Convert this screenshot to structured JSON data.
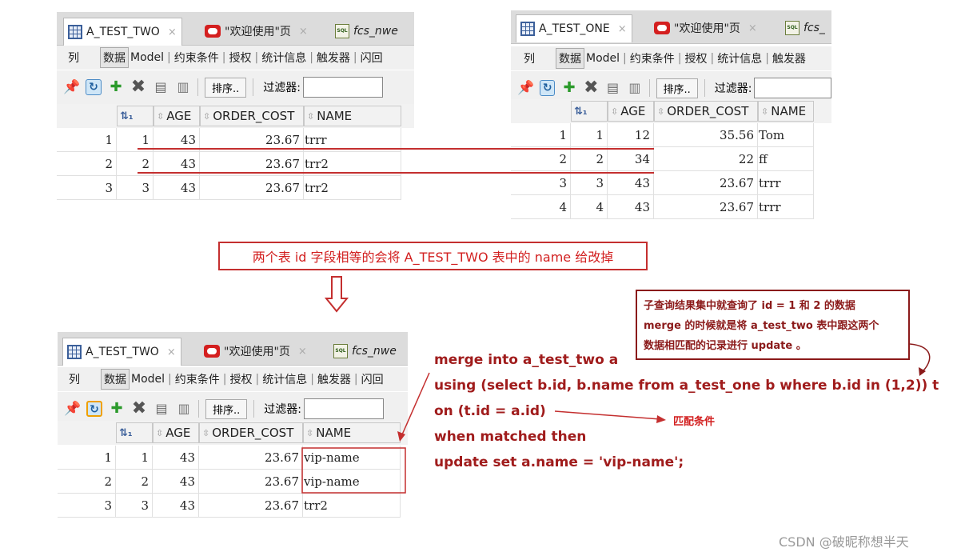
{
  "panels": {
    "top_left": {
      "tabs": [
        {
          "label": "A_TEST_TWO",
          "icon": "table-grid-icon",
          "close": "×"
        },
        {
          "label": "\"欢迎使用\"页",
          "icon": "oracle-icon",
          "close": "×"
        },
        {
          "label": "fcs_nwe",
          "icon": "sql-worksheet-icon"
        }
      ],
      "subtabs": [
        "列",
        "数据",
        "Model",
        "约束条件",
        "授权",
        "统计信息",
        "触发器",
        "闪回"
      ],
      "toolbar": {
        "sort_label": "排序..",
        "filter_label": "过滤器:"
      },
      "columns": [
        "",
        "AGE",
        "ORDER_COST",
        "NAME"
      ],
      "rows": [
        {
          "n": "1",
          "id": "1",
          "age": "43",
          "cost": "23.67",
          "name": "trrr"
        },
        {
          "n": "2",
          "id": "2",
          "age": "43",
          "cost": "23.67",
          "name": "trr2"
        },
        {
          "n": "3",
          "id": "3",
          "age": "43",
          "cost": "23.67",
          "name": "trr2"
        }
      ]
    },
    "top_right": {
      "tabs": [
        {
          "label": "A_TEST_ONE",
          "icon": "table-grid-icon",
          "close": "×"
        },
        {
          "label": "\"欢迎使用\"页",
          "icon": "oracle-icon",
          "close": "×"
        },
        {
          "label": "fcs_",
          "icon": "sql-worksheet-icon"
        }
      ],
      "subtabs": [
        "列",
        "数据",
        "Model",
        "约束条件",
        "授权",
        "统计信息",
        "触发器"
      ],
      "toolbar": {
        "sort_label": "排序..",
        "filter_label": "过滤器:"
      },
      "columns": [
        "",
        "AGE",
        "ORDER_COST",
        "NAME"
      ],
      "rows": [
        {
          "n": "1",
          "id": "1",
          "age": "12",
          "cost": "35.56",
          "name": "Tom"
        },
        {
          "n": "2",
          "id": "2",
          "age": "34",
          "cost": "22",
          "name": "ff"
        },
        {
          "n": "3",
          "id": "3",
          "age": "43",
          "cost": "23.67",
          "name": "trrr"
        },
        {
          "n": "4",
          "id": "4",
          "age": "43",
          "cost": "23.67",
          "name": "trrr"
        }
      ]
    },
    "bottom": {
      "tabs": [
        {
          "label": "A_TEST_TWO",
          "icon": "table-grid-icon",
          "close": "×"
        },
        {
          "label": "\"欢迎使用\"页",
          "icon": "oracle-icon",
          "close": "×"
        },
        {
          "label": "fcs_nwe",
          "icon": "sql-worksheet-icon"
        }
      ],
      "subtabs": [
        "列",
        "数据",
        "Model",
        "约束条件",
        "授权",
        "统计信息",
        "触发器",
        "闪回"
      ],
      "toolbar": {
        "sort_label": "排序..",
        "filter_label": "过滤器:"
      },
      "columns": [
        "",
        "AGE",
        "ORDER_COST",
        "NAME"
      ],
      "rows": [
        {
          "n": "1",
          "id": "1",
          "age": "43",
          "cost": "23.67",
          "name": "vip-name"
        },
        {
          "n": "2",
          "id": "2",
          "age": "43",
          "cost": "23.67",
          "name": "vip-name"
        },
        {
          "n": "3",
          "id": "3",
          "age": "43",
          "cost": "23.67",
          "name": "trr2"
        }
      ]
    }
  },
  "annotations": {
    "caption": "两个表 id 字段相等的会将 A_TEST_TWO 表中的 name 给改掉",
    "subquery_note": [
      "子查询结果集中就查询了 id = 1 和 2 的数据",
      "merge 的时候就是将 a_test_two 表中跟这两个",
      "数据相匹配的记录进行 update 。"
    ],
    "sql_lines": [
      "merge into a_test_two a",
      "using (select b.id, b.name from a_test_one b where b.id in (1,2)) t",
      "on (t.id = a.id)",
      "when matched then",
      "update set a.name = 'vip-name';"
    ],
    "match_label": "匹配条件"
  },
  "watermark": "CSDN @破昵称想半天",
  "colors": {
    "accent_red": "#c42f2f",
    "dark_red": "#8b1a1a",
    "sql_red": "#a01c1c"
  }
}
